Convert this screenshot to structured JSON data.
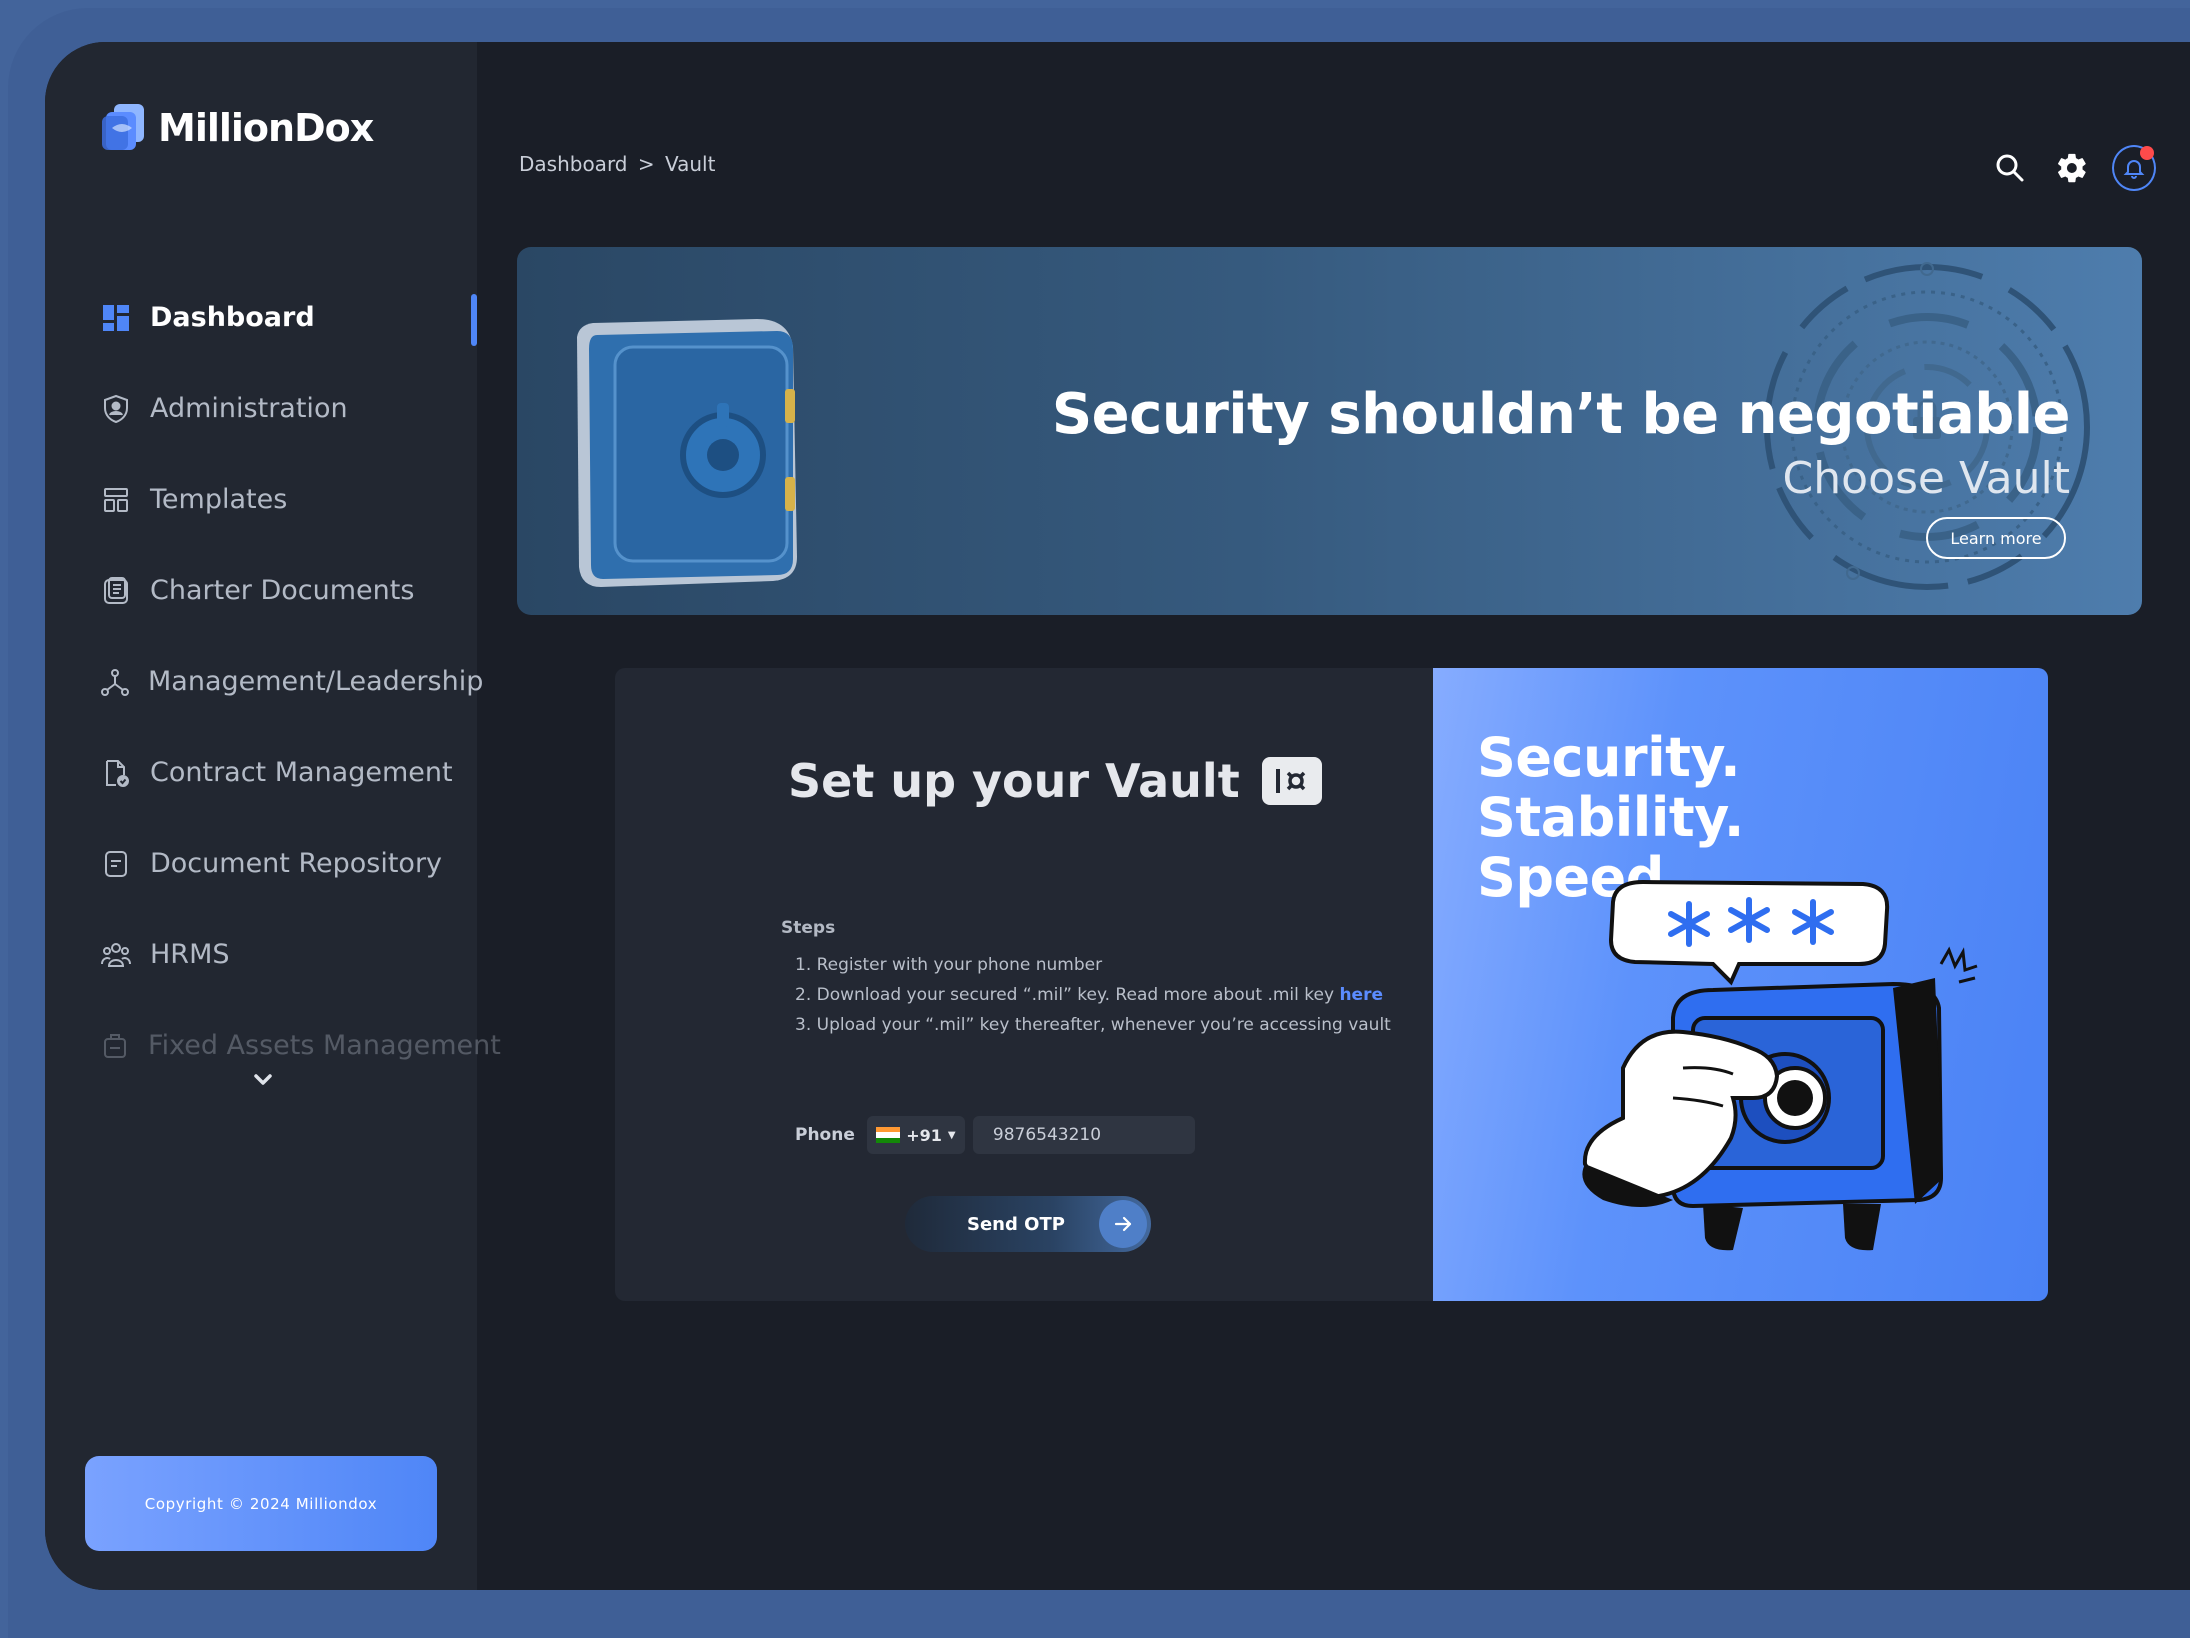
{
  "app": {
    "name": "MillionDox"
  },
  "sidebar": {
    "items": [
      {
        "label": "Dashboard",
        "icon": "grid-icon",
        "active": true
      },
      {
        "label": "Administration",
        "icon": "shield-user-icon"
      },
      {
        "label": "Templates",
        "icon": "layout-icon"
      },
      {
        "label": "Charter Documents",
        "icon": "document-stack-icon"
      },
      {
        "label": "Management/Leadership",
        "icon": "hierarchy-icon"
      },
      {
        "label": "Contract Management",
        "icon": "document-check-icon"
      },
      {
        "label": "Document Repository",
        "icon": "document-icon"
      },
      {
        "label": "HRMS",
        "icon": "people-icon"
      },
      {
        "label": "Fixed Assets Management",
        "icon": "asset-icon"
      }
    ],
    "more_icon": "chevron-down-icon",
    "copyright": "Copyright © 2024 Milliondox"
  },
  "header": {
    "breadcrumb": {
      "root": "Dashboard",
      "separator": ">",
      "current": "Vault"
    },
    "icons": [
      "search-icon",
      "gear-icon",
      "bell-icon"
    ]
  },
  "banner": {
    "title": "Security shouldn’t be negotiable",
    "subtitle": "Choose Vault",
    "button": "Learn more"
  },
  "vault_setup": {
    "title": "Set up your Vault",
    "steps_heading": "Steps",
    "steps": [
      {
        "text": "1. Register with your phone number"
      },
      {
        "text": "2. Download your secured “.mil” key. Read more about .mil key ",
        "link": "here"
      },
      {
        "text": "3. Upload your “.mil” key thereafter, whenever you’re accessing vault"
      }
    ],
    "phone_label": "Phone",
    "country_code": "+91",
    "phone_value": "9876543210",
    "send_button": "Send OTP"
  },
  "promo": {
    "lines": [
      "Security.",
      "Stability.",
      "Speed."
    ]
  },
  "colors": {
    "accent": "#4f86f7",
    "background": "#1a1e27",
    "sidebar": "#222731",
    "alert": "#ff4b4b"
  }
}
